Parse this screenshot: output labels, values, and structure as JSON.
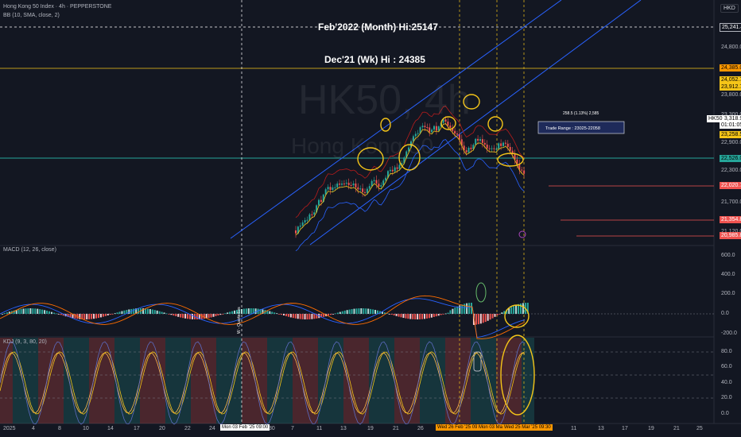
{
  "header": {
    "title": "Hong Kong 50 Index · 4h · PEPPERSTONE",
    "indicator": "BB (10, SMA, close, 2)",
    "currency": "HKD"
  },
  "watermark": {
    "symbol": "HK50, 4h",
    "name": "Hong Kong 50"
  },
  "annotations": {
    "feb_high": "Feb'2022 (Month) Hi:25147",
    "dec_high": "Dec'21 (Wk) Hi : 24385",
    "range_top": "258.5 (1.13%) 2,585",
    "trade_range": "Trade Range : 23025-22058",
    "vertical_text": "W - Quarterlies"
  },
  "price_axis": {
    "ticks": [
      "24,800.0",
      "24,200.0",
      "23,800.0",
      "23,300.0",
      "22,900.0",
      "22,300.0",
      "21,700.0",
      "21,120.0"
    ],
    "tags": [
      {
        "text": "25,241.4",
        "bg": "#131722",
        "fg": "#ffffff",
        "border": "#b2b5be"
      },
      {
        "text": "24,385.0",
        "bg": "#ff9800",
        "fg": "#000000"
      },
      {
        "text": "24,052.7",
        "bg": "#f5c518",
        "fg": "#000000"
      },
      {
        "text": "23,912.7",
        "bg": "#f5c518",
        "fg": "#000000"
      },
      {
        "text": "23,318.9",
        "bg": "#ffffff",
        "fg": "#000000"
      },
      {
        "text": "01:01:05",
        "bg": "#ffffff",
        "fg": "#000000"
      },
      {
        "text": "23,258.5",
        "bg": "#f5c518",
        "fg": "#000000"
      },
      {
        "text": "22,526.0",
        "bg": "#26a69a",
        "fg": "#000000"
      },
      {
        "text": "22,020.7",
        "bg": "#ef5350",
        "fg": "#ffffff"
      },
      {
        "text": "21,354.8",
        "bg": "#ef5350",
        "fg": "#ffffff"
      },
      {
        "text": "20,985.8",
        "bg": "#ef5350",
        "fg": "#ffffff"
      }
    ],
    "symbol_tag": "HK50"
  },
  "macd": {
    "label": "MACD (12, 26, close)",
    "ticks": [
      "600.0",
      "400.0",
      "200.0",
      "0.0",
      "-200.0"
    ]
  },
  "kdj": {
    "label": "KDJ (9, 3, 80, 20)",
    "ticks": [
      "80.0",
      "60.0",
      "40.0",
      "20.0",
      "0.0"
    ]
  },
  "time_axis": {
    "labels": [
      "2025",
      "4",
      "8",
      "10",
      "14",
      "17",
      "20",
      "22",
      "24",
      "30",
      "7",
      "11",
      "13",
      "19",
      "21",
      "26",
      "7",
      "11",
      "13",
      "17",
      "19",
      "21",
      "25"
    ],
    "highlights": [
      {
        "text": "Mon 03 Feb '25   09:00",
        "bg": "#ffffff",
        "fg": "#000000"
      },
      {
        "text": "Wed 26 Feb '25   09:30",
        "bg": "#ff9800",
        "fg": "#000000"
      },
      {
        "text": "Mon 03 Mar '25",
        "bg": "#ff9800",
        "fg": "#000000"
      },
      {
        "text": "Wed 25 Mar '25   09:30",
        "bg": "#ff9800",
        "fg": "#000000"
      }
    ]
  },
  "colors": {
    "background": "#131722",
    "up": "#26a69a",
    "down": "#ef5350",
    "macd_line": "#2962ff",
    "signal_line": "#ff6d00",
    "channel": "#2962ff",
    "highlight": "#f5c518",
    "bb_mid": "#f5c518",
    "bb_band": "#b71c1c"
  }
}
